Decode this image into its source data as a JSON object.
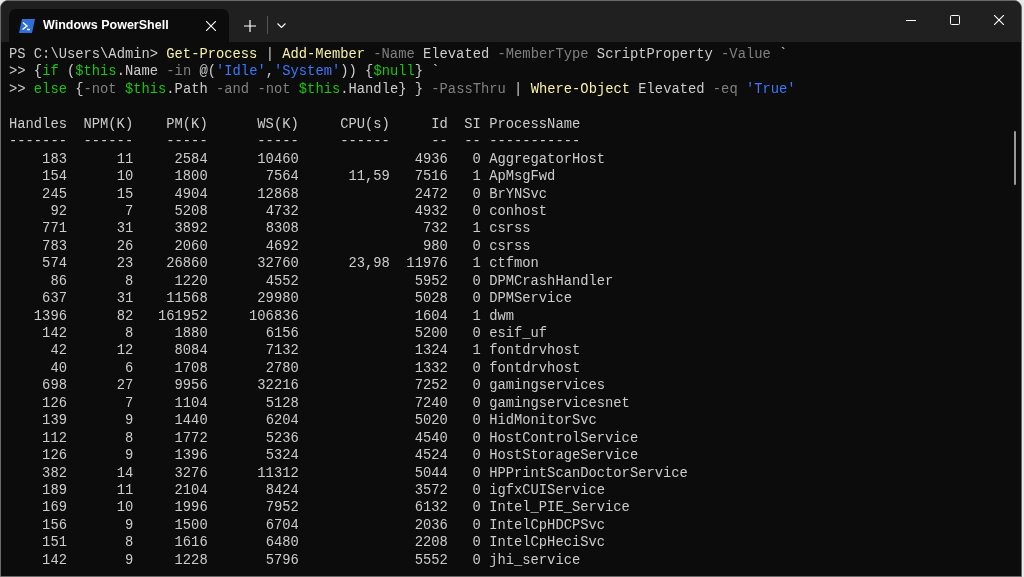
{
  "window": {
    "tabs": [
      {
        "title": "Windows PowerShell",
        "selected": true
      }
    ]
  },
  "terminal": {
    "command_lines": [
      {
        "segments": [
          {
            "kind": "plain",
            "text": "PS C:\\Users\\Admin> "
          },
          {
            "kind": "cmdlet",
            "text": "Get-Process"
          },
          {
            "kind": "plain",
            "text": " | "
          },
          {
            "kind": "cmdlet",
            "text": "Add-Member"
          },
          {
            "kind": "param",
            "text": " -Name"
          },
          {
            "kind": "plain",
            "text": " Elevated "
          },
          {
            "kind": "param",
            "text": "-MemberType"
          },
          {
            "kind": "plain",
            "text": " ScriptProperty "
          },
          {
            "kind": "param",
            "text": "-Value"
          },
          {
            "kind": "plain",
            "text": " `"
          }
        ]
      },
      {
        "segments": [
          {
            "kind": "plain",
            "text": ">> {"
          },
          {
            "kind": "keyword",
            "text": "if"
          },
          {
            "kind": "plain",
            "text": " ("
          },
          {
            "kind": "variable",
            "text": "$this"
          },
          {
            "kind": "plain",
            "text": ".Name "
          },
          {
            "kind": "param",
            "text": "-in"
          },
          {
            "kind": "plain",
            "text": " @("
          },
          {
            "kind": "string",
            "text": "'Idle'"
          },
          {
            "kind": "plain",
            "text": ","
          },
          {
            "kind": "string",
            "text": "'System'"
          },
          {
            "kind": "plain",
            "text": ")) {"
          },
          {
            "kind": "variable",
            "text": "$null"
          },
          {
            "kind": "plain",
            "text": "} `"
          }
        ]
      },
      {
        "segments": [
          {
            "kind": "plain",
            "text": ">> "
          },
          {
            "kind": "keyword",
            "text": "else"
          },
          {
            "kind": "plain",
            "text": " {"
          },
          {
            "kind": "param",
            "text": "-not "
          },
          {
            "kind": "variable",
            "text": "$this"
          },
          {
            "kind": "plain",
            "text": ".Path "
          },
          {
            "kind": "param",
            "text": "-and -not "
          },
          {
            "kind": "variable",
            "text": "$this"
          },
          {
            "kind": "plain",
            "text": ".Handle} } "
          },
          {
            "kind": "param",
            "text": "-PassThru"
          },
          {
            "kind": "plain",
            "text": " | "
          },
          {
            "kind": "cmdlet",
            "text": "Where-Object"
          },
          {
            "kind": "plain",
            "text": " Elevated "
          },
          {
            "kind": "param",
            "text": "-eq "
          },
          {
            "kind": "string",
            "text": "'True'"
          }
        ]
      }
    ],
    "table": {
      "columns": [
        "Handles",
        "NPM(K)",
        "PM(K)",
        "WS(K)",
        "CPU(s)",
        "Id",
        "SI",
        "ProcessName"
      ],
      "separators": [
        "-------",
        "------",
        "-----",
        "-----",
        "------",
        "--",
        "--",
        "-----------"
      ],
      "rows": [
        [
          "183",
          "11",
          "2584",
          "10460",
          null,
          "4936",
          "0",
          "AggregatorHost"
        ],
        [
          "154",
          "10",
          "1800",
          "7564",
          "11,59",
          "7516",
          "1",
          "ApMsgFwd"
        ],
        [
          "245",
          "15",
          "4904",
          "12868",
          null,
          "2472",
          "0",
          "BrYNSvc"
        ],
        [
          "92",
          "7",
          "5208",
          "4732",
          null,
          "4932",
          "0",
          "conhost"
        ],
        [
          "771",
          "31",
          "3892",
          "8308",
          null,
          "732",
          "1",
          "csrss"
        ],
        [
          "783",
          "26",
          "2060",
          "4692",
          null,
          "980",
          "0",
          "csrss"
        ],
        [
          "574",
          "23",
          "26860",
          "32760",
          "23,98",
          "11976",
          "1",
          "ctfmon"
        ],
        [
          "86",
          "8",
          "1220",
          "4552",
          null,
          "5952",
          "0",
          "DPMCrashHandler"
        ],
        [
          "637",
          "31",
          "11568",
          "29980",
          null,
          "5028",
          "0",
          "DPMService"
        ],
        [
          "1396",
          "82",
          "161952",
          "106836",
          null,
          "1604",
          "1",
          "dwm"
        ],
        [
          "142",
          "8",
          "1880",
          "6156",
          null,
          "5200",
          "0",
          "esif_uf"
        ],
        [
          "42",
          "12",
          "8084",
          "7132",
          null,
          "1324",
          "1",
          "fontdrvhost"
        ],
        [
          "40",
          "6",
          "1708",
          "2780",
          null,
          "1332",
          "0",
          "fontdrvhost"
        ],
        [
          "698",
          "27",
          "9956",
          "32216",
          null,
          "7252",
          "0",
          "gamingservices"
        ],
        [
          "126",
          "7",
          "1104",
          "5128",
          null,
          "7240",
          "0",
          "gamingservicesnet"
        ],
        [
          "139",
          "9",
          "1440",
          "6204",
          null,
          "5020",
          "0",
          "HidMonitorSvc"
        ],
        [
          "112",
          "8",
          "1772",
          "5236",
          null,
          "4540",
          "0",
          "HostControlService"
        ],
        [
          "126",
          "9",
          "1396",
          "5324",
          null,
          "4524",
          "0",
          "HostStorageService"
        ],
        [
          "382",
          "14",
          "3276",
          "11312",
          null,
          "5044",
          "0",
          "HPPrintScanDoctorService"
        ],
        [
          "189",
          "11",
          "2104",
          "8424",
          null,
          "3572",
          "0",
          "igfxCUIService"
        ],
        [
          "169",
          "10",
          "1996",
          "7952",
          null,
          "6132",
          "0",
          "Intel_PIE_Service"
        ],
        [
          "156",
          "9",
          "1500",
          "6704",
          null,
          "2036",
          "0",
          "IntelCpHDCPSvc"
        ],
        [
          "151",
          "8",
          "1616",
          "6480",
          null,
          "2208",
          "0",
          "IntelCpHeciSvc"
        ],
        [
          "142",
          "9",
          "1228",
          "5796",
          null,
          "5552",
          "0",
          "jhi_service"
        ]
      ]
    }
  }
}
